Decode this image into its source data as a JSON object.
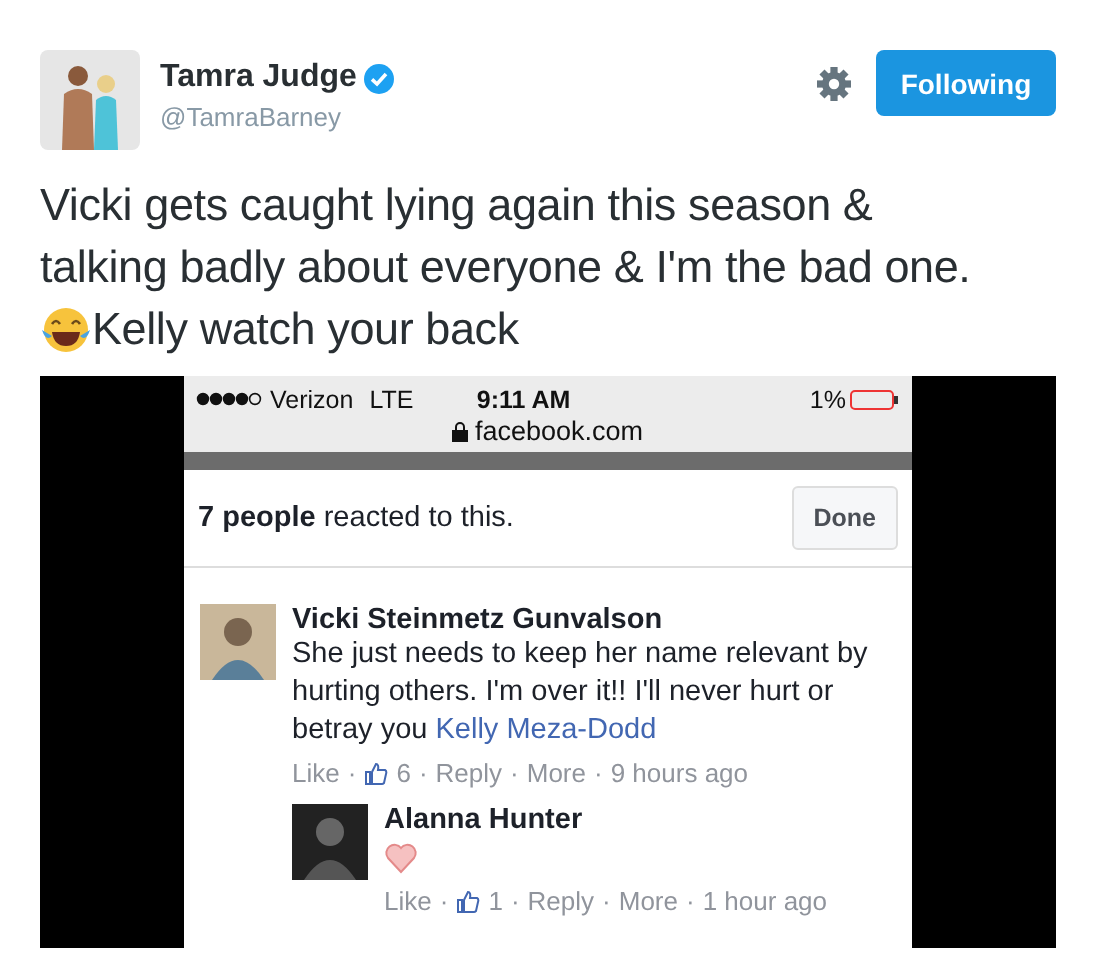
{
  "tweet": {
    "author": {
      "name": "Tamra Judge",
      "handle": "@TamraBarney",
      "verified": true
    },
    "follow_button": {
      "label": "Following"
    },
    "text": "Vicki gets caught lying again this season & talking badly about everyone & I'm the bad one.",
    "text_after_emoji": "Kelly watch your back"
  },
  "media": {
    "kind": "screenshot",
    "status_bar": {
      "carrier": "Verizon",
      "network": "LTE",
      "time": "9:11 AM",
      "battery": "1%",
      "address": "facebook.com"
    },
    "reactions": {
      "summary": "**7 people** reacted to this.",
      "button": "Done"
    },
    "separator": "·",
    "comments": [
      {
        "author": "Vicki Steinmetz Gunvalson",
        "text": "She just needs to keep her name relevant by hurting others. I'm over it!! I'll never hurt or betray you",
        "mention": "Kelly Meza-Dodd",
        "like": "Like",
        "likes": "6",
        "reply": "Reply",
        "more": "More",
        "time": "9 hours ago",
        "replies": [
          {
            "author": "Alanna Hunter",
            "heart_sticker": true,
            "like": "Like",
            "likes": "1",
            "reply": "Reply",
            "more": "More",
            "time": "1 hour ago"
          }
        ]
      }
    ]
  }
}
